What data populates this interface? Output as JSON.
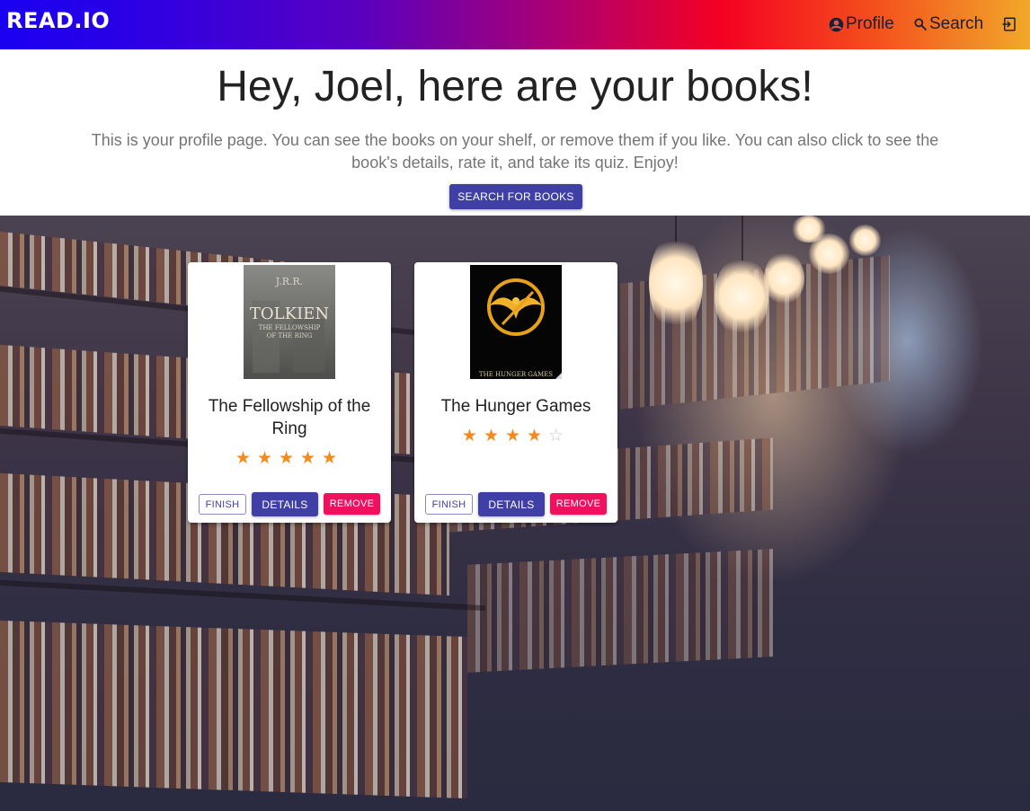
{
  "navbar": {
    "brand": "READ.IO",
    "profile_label": "Profile",
    "search_label": "Search"
  },
  "hero": {
    "heading": "Hey, Joel, here are your books!",
    "description": "This is your profile page. You can see the books on your shelf, or remove them if you like. You can also click to see the book's details, rate it, and take its quiz. Enjoy!",
    "search_button": "SEARCH FOR BOOKS"
  },
  "books": [
    {
      "title": "The Fellowship of the Ring",
      "rating": 5,
      "max_rating": 5,
      "stars": "★★★★★",
      "empty_stars": "",
      "cover": {
        "author_line": "J.R.R.",
        "name_line": "TOLKIEN",
        "subtitle_1": "THE FELLOWSHIP",
        "subtitle_2": "OF THE RING"
      },
      "finish_label": "FINISH",
      "details_label": "DETAILS",
      "remove_label": "REMOVE"
    },
    {
      "title": "The Hunger Games",
      "rating": 4,
      "max_rating": 5,
      "stars": "★★★★",
      "empty_stars": "☆",
      "cover": {
        "caption": "THE HUNGER GAMES"
      },
      "finish_label": "FINISH",
      "details_label": "DETAILS",
      "remove_label": "REMOVE"
    }
  ],
  "colors": {
    "primary": "#3f3fa6",
    "accent_remove": "#f0115e",
    "star": "#f5891f",
    "nav_gradient_start": "#1a00f2",
    "nav_gradient_end": "#f2a82a"
  }
}
